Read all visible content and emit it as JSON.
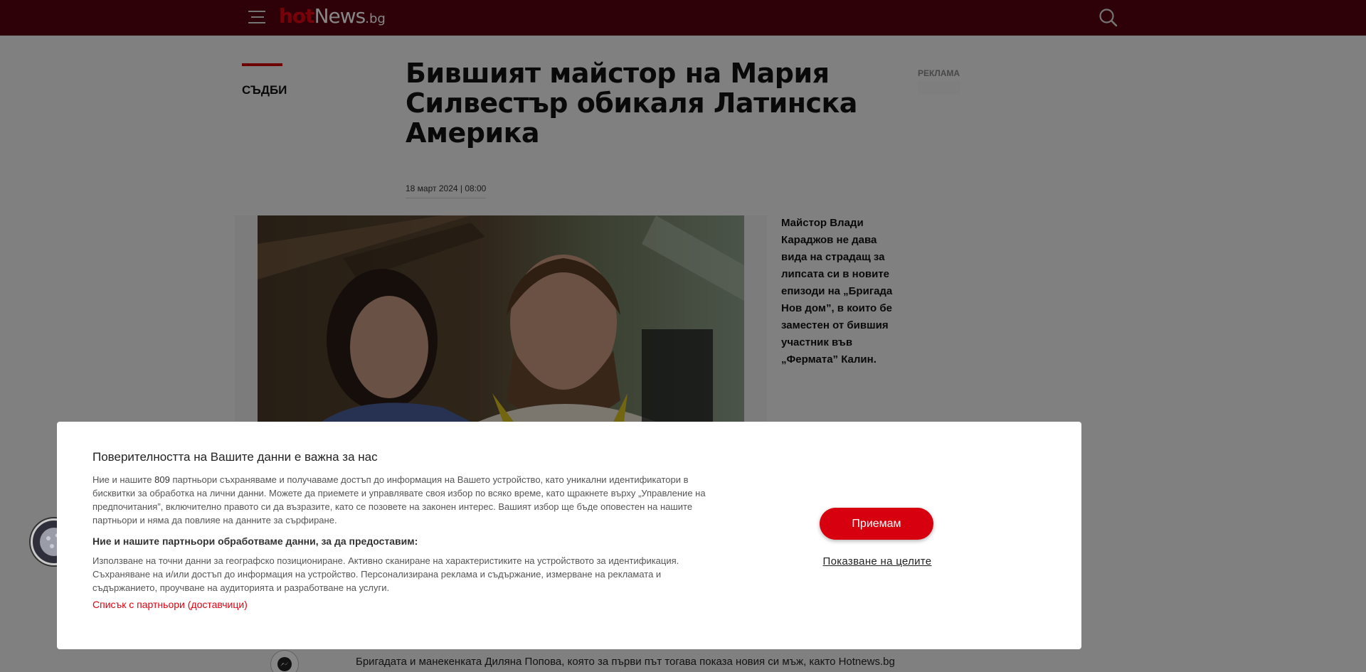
{
  "header": {
    "logo_hot": "hot",
    "logo_news": "News",
    "logo_bg": ".bg",
    "menu_icon": "hamburger-icon",
    "search_icon": "search-icon"
  },
  "article": {
    "category": "СЪДБИ",
    "headline": "Бившият майстор на Мария Силвестър обикаля Латинска Америка",
    "ad_label": "РЕКЛАМА",
    "date": "18 март 2024 | 08:00",
    "lead": "Майстор Влади Караджов не дава вида на страдащ за липсата си в новите епизоди на „Бригада Нов дом”, в които бе заместен от бившия участник във „Фермата” Калин.",
    "body_line1": "Бригадата и манекенката Диляна Попова, която за първи път тогава показа новия си мъж, както Hotnews.bg"
  },
  "consent": {
    "title": "Поверителността на Вашите данни е важна за нас",
    "text_before": "Ние и нашите ",
    "partners_count": "809",
    "text_after": " партньори съхраняваме и получаваме достъп до информация на Вашето устройство, като уникални идентификатори в бисквитки за обработка на лични данни. Можете да приемете и управлявате своя избор по всяко време, като щракнете върху „Управление на предпочитания”, включително правото си да възразите, като се позовете на законен интерес. Вашият избор ще бъде оповестен на нашите партньори и няма да повлияе на данните за сърфиране.",
    "subtitle": "Ние и нашите партньори обработваме данни, за да предоставим:",
    "purposes": "Използване на точни данни за географско позициониране. Активно сканиране на характеристиките на устройството за идентификация. Съхраняване на и/или достъп до информация на устройство. Персонализирана реклама и съдържание, измерване на рекламата и съдържанието, проучване на аудиторията и разработване на услуги.",
    "partners_link": "Списък с партньори (доставчици)",
    "accept_label": "Приемам",
    "show_purposes_label": "Показване на целите"
  },
  "colors": {
    "brand_bar": "#580010",
    "accent_red": "#d6000f",
    "overlay": "rgba(0,0,0,0.47)"
  }
}
